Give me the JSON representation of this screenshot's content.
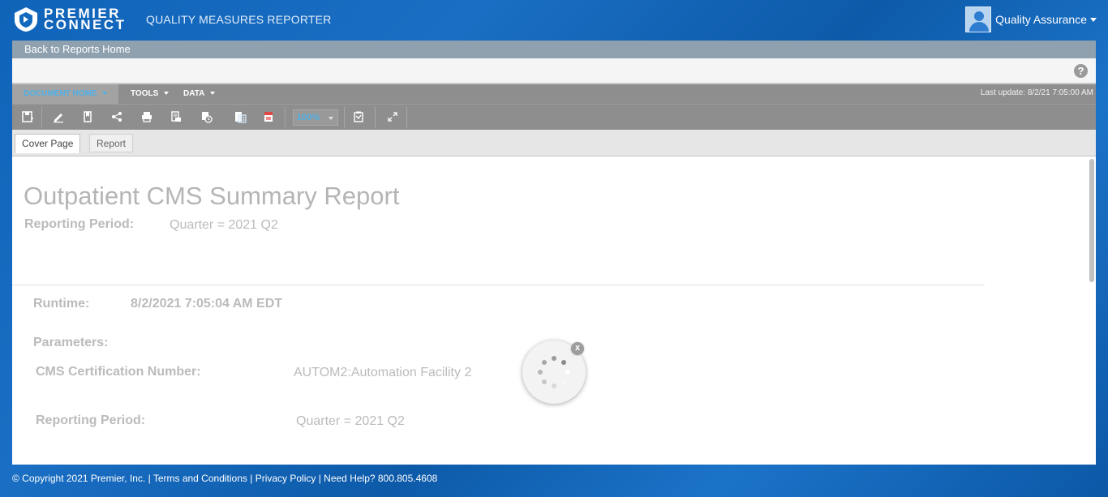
{
  "header": {
    "logo_line1": "PREMIER",
    "logo_line2": "CONNECT",
    "app_title": "QUALITY MEASURES REPORTER",
    "user_name": "Quality Assurance"
  },
  "back_link": "Back to Reports Home",
  "help_icon": "?",
  "menu": {
    "items": [
      {
        "label": "DOCUMENT HOME"
      },
      {
        "label": "TOOLS"
      },
      {
        "label": "DATA"
      }
    ],
    "last_update": "Last update: 8/2/21 7:05:00 AM"
  },
  "toolbar": {
    "icons": [
      "save-icon",
      "edit-icon",
      "bookmark-icon",
      "share-icon",
      "print-icon",
      "export-icon",
      "schedule-icon",
      "excel-icon",
      "pdf-icon",
      "filter-icon",
      "fullscreen-icon"
    ],
    "zoom": "100%"
  },
  "tabs": [
    {
      "label": "Cover Page",
      "active": true
    },
    {
      "label": "Report",
      "active": false
    }
  ],
  "report": {
    "title": "Outpatient CMS Summary Report",
    "reporting_period_label": "Reporting Period:",
    "reporting_period_value": "Quarter = 2021 Q2",
    "runtime_label": "Runtime:",
    "runtime_value": "8/2/2021 7:05:04 AM EDT",
    "parameters_label": "Parameters:",
    "cms_label": "CMS Certification Number:",
    "cms_value": "AUTOM2:Automation Facility 2",
    "param_period_label": "Reporting Period:",
    "param_period_value": "Quarter = 2021 Q2"
  },
  "spinner": {
    "close_label": "x"
  },
  "footer": {
    "copyright": "© Copyright 2021 Premier, Inc. | ",
    "terms": "Terms and Conditions",
    "sep1": " | ",
    "privacy": "Privacy Policy",
    "sep2": " | ",
    "help": "Need Help? 800.805.4608"
  },
  "colors": {
    "background": "#1269bd",
    "menu_active": "#4fb1e8",
    "toolbar": "#8e8e8e",
    "back_bar": "#8fa0ae"
  }
}
